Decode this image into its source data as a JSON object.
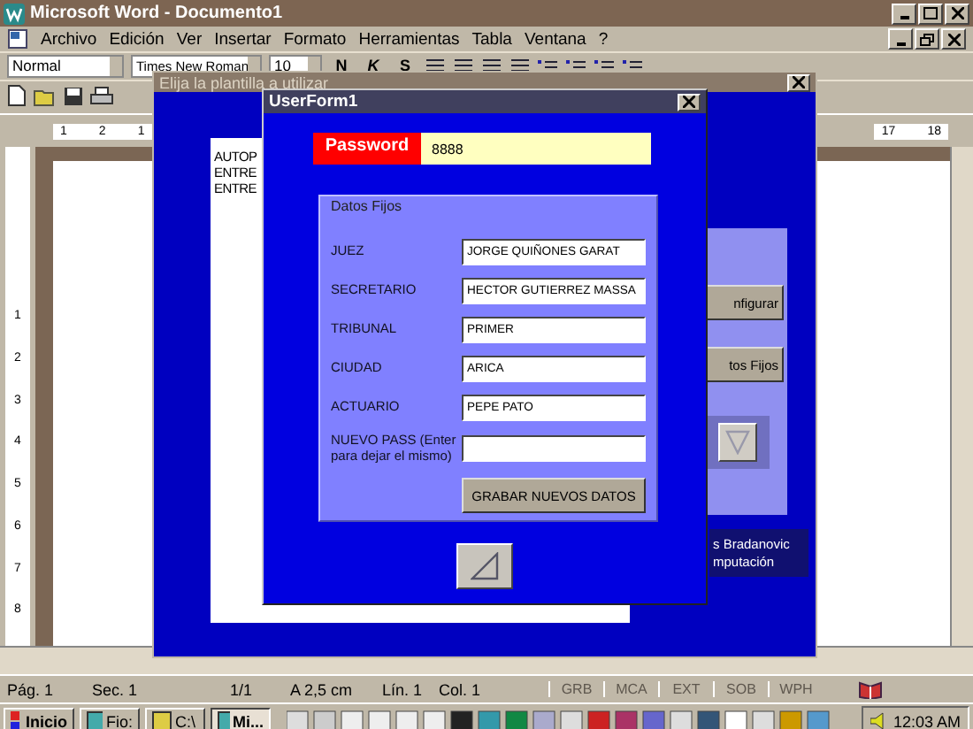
{
  "word_window": {
    "title": "Microsoft Word - Documento1"
  },
  "menu_bar": [
    "Archivo",
    "Edición",
    "Ver",
    "Insertar",
    "Formato",
    "Herramientas",
    "Tabla",
    "Ventana",
    "?"
  ],
  "format_toolbar": {
    "style": "Normal",
    "font": "Times New Roman",
    "size": "10",
    "buttons": [
      "N",
      "K",
      "S"
    ]
  },
  "ruler": {
    "left_labels": [
      "1",
      "2",
      "1"
    ],
    "right_labels": [
      "17",
      "18"
    ],
    "vertical_labels": [
      "1",
      "2",
      "3",
      "4",
      "5",
      "6",
      "7",
      "8"
    ]
  },
  "template_dialog": {
    "title": "Elija la plantilla a utilizar",
    "list": [
      "AUTOP",
      "ENTRE",
      "ENTRE"
    ],
    "buttons": [
      "nfigurar",
      "tos Fijos"
    ],
    "credit": [
      "s Bradanovic",
      "mputación"
    ]
  },
  "userform": {
    "title": "UserForm1",
    "password_label": "Password",
    "password_value": "8888",
    "frame_title": "Datos Fijos",
    "fields": [
      {
        "label": "JUEZ",
        "value": "JORGE QUIÑONES GARAT"
      },
      {
        "label": "SECRETARIO",
        "value": "HECTOR GUTIERREZ MASSA"
      },
      {
        "label": "TRIBUNAL",
        "value": "PRIMER"
      },
      {
        "label": "CIUDAD",
        "value": "ARICA"
      },
      {
        "label": "ACTUARIO",
        "value": "PEPE PATO"
      },
      {
        "label": "NUEVO PASS (Enter para dejar el mismo)"
      }
    ],
    "save_button": "GRABAR NUEVOS DATOS"
  },
  "status_bar": {
    "items": [
      "Pág. 1",
      "Sec. 1",
      "1/1",
      "A 2,5 cm",
      "Lín. 1",
      "Col. 1"
    ],
    "modes": [
      {
        "label": "GRB",
        "on": false
      },
      {
        "label": "MCA",
        "on": false
      },
      {
        "label": "EXT",
        "on": false
      },
      {
        "label": "SOB",
        "on": false
      },
      {
        "label": "WPH",
        "on": false
      }
    ]
  },
  "taskbar": {
    "start": "Inicio",
    "tasks": [
      {
        "label": "Fio:",
        "selected": false
      },
      {
        "label": "C:\\",
        "selected": false
      },
      {
        "label": "Mi...",
        "selected": true
      }
    ],
    "clock": "12:03 AM"
  }
}
